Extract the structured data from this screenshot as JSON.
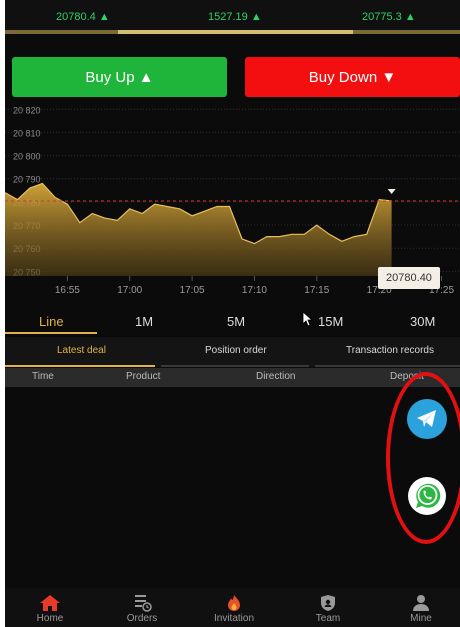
{
  "ticker": [
    {
      "value": "20780.4",
      "arrow": "▲"
    },
    {
      "value": "1527.19",
      "arrow": "▲"
    },
    {
      "value": "20775.3",
      "arrow": "▲"
    }
  ],
  "buttons": {
    "buy_up": "Buy Up ▲",
    "buy_down": "Buy Down ▼"
  },
  "chart": {
    "y_ticks": [
      "20 820",
      "20 810",
      "20 800",
      "20 790",
      "20 780",
      "20 770",
      "20 760",
      "20 750"
    ],
    "x_ticks": [
      "16:55",
      "17:00",
      "17:05",
      "17:10",
      "17:15",
      "17:20",
      "17:25"
    ],
    "current_price": "20780.40"
  },
  "chart_data": {
    "type": "area",
    "title": "",
    "xlabel": "",
    "ylabel": "",
    "ylim": [
      20748,
      20824
    ],
    "x_range": [
      "16:50",
      "17:26"
    ],
    "reference_line": {
      "value": 20780.4,
      "style": "dashed",
      "color": "#d23a2a"
    },
    "x": [
      "16:50",
      "16:51",
      "16:52",
      "16:53",
      "16:54",
      "16:55",
      "16:56",
      "16:57",
      "16:58",
      "16:59",
      "17:00",
      "17:01",
      "17:02",
      "17:03",
      "17:04",
      "17:05",
      "17:06",
      "17:07",
      "17:08",
      "17:09",
      "17:10",
      "17:11",
      "17:12",
      "17:13",
      "17:14",
      "17:15",
      "17:16",
      "17:17",
      "17:18",
      "17:19",
      "17:20",
      "17:21"
    ],
    "series": [
      {
        "values": [
          20784,
          20781,
          20786,
          20788,
          20782,
          20779,
          20771,
          20775,
          20773,
          20772,
          20777,
          20775,
          20779,
          20778,
          20777,
          20774,
          20776,
          20778,
          20778,
          20764,
          20762,
          20765,
          20765,
          20766,
          20766,
          20770,
          20766,
          20763,
          20765,
          20766,
          20781,
          20780.4
        ]
      }
    ],
    "colors": {
      "fill": "#c99a2f",
      "line": "#e8c05a"
    }
  },
  "timeframes": [
    "Line",
    "1M",
    "5M",
    "15M",
    "30M"
  ],
  "active_timeframe": "Line",
  "record_tabs": [
    "Latest deal",
    "Position order",
    "Transaction records"
  ],
  "active_record_tab": "Latest deal",
  "table_headers": [
    "Time",
    "Product",
    "Direction",
    "Deposit"
  ],
  "nav": [
    {
      "label": "Home",
      "icon": "home-icon"
    },
    {
      "label": "Orders",
      "icon": "orders-icon"
    },
    {
      "label": "Invitation",
      "icon": "fire-icon"
    },
    {
      "label": "Team",
      "icon": "shield-icon"
    },
    {
      "label": "Mine",
      "icon": "user-icon"
    }
  ],
  "colors": {
    "up": "#1fb53a",
    "down": "#f30f0f",
    "accent": "#e2b24a",
    "ticker_green": "#2fd16a"
  }
}
